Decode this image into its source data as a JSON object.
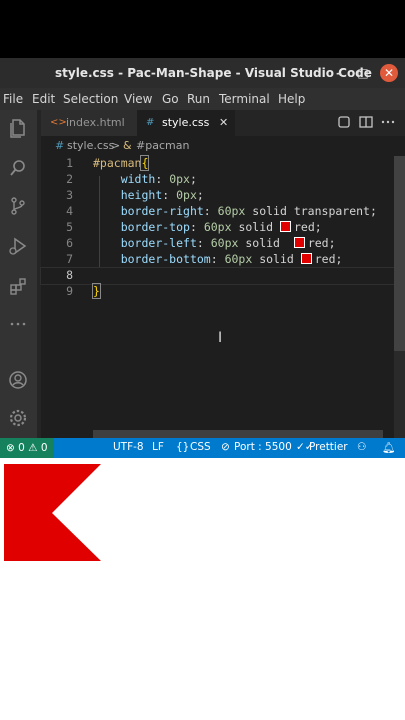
{
  "window": {
    "title": "style.css - Pac-Man-Shape - Visual Studio Code",
    "controls": [
      "–",
      "□",
      "✕"
    ]
  },
  "menu": [
    "File",
    "Edit",
    "Selection",
    "View",
    "Go",
    "Run",
    "Terminal",
    "Help"
  ],
  "activity_icons": [
    "files-icon",
    "search-icon",
    "source-control-icon",
    "run-debug-icon",
    "extensions-icon",
    "more-icon",
    "account-icon",
    "settings-gear-icon"
  ],
  "tabs": [
    {
      "label": "index.html",
      "icon": "html-file-icon",
      "active": false
    },
    {
      "label": "style.css",
      "icon": "css-file-icon",
      "active": true,
      "close": "✕"
    }
  ],
  "breadcrumb": {
    "file": "style.css",
    "separator": ">",
    "symbol": "#pacman"
  },
  "editor": {
    "lines": [
      {
        "n": "1",
        "selector": "#pacman",
        "brace": "{"
      },
      {
        "n": "2",
        "prop": "width",
        "num": "0px",
        "rest": ""
      },
      {
        "n": "3",
        "prop": "height",
        "num": "0px",
        "rest": ""
      },
      {
        "n": "4",
        "prop": "border-right",
        "num": "60px",
        "rest": " solid transparent"
      },
      {
        "n": "5",
        "prop": "border-top",
        "num": "60px",
        "rest": " solid ",
        "color": "red"
      },
      {
        "n": "6",
        "prop": "border-left",
        "num": "60px",
        "rest": " solid  ",
        "color": "red"
      },
      {
        "n": "7",
        "prop": "border-bottom",
        "num": "60px",
        "rest": " solid ",
        "color": "red"
      },
      {
        "n": "8"
      },
      {
        "n": "9",
        "brace": "}"
      }
    ],
    "current_line": "8"
  },
  "statusbar": {
    "problems": "⊗ 0 ⚠ 0",
    "encoding": "UTF-8",
    "eol": "LF",
    "language": "CSS",
    "port": "Port : 5500",
    "prettier": "Prettier"
  },
  "colors": {
    "accent": "#007acc",
    "pacman_red": "#e00000"
  }
}
